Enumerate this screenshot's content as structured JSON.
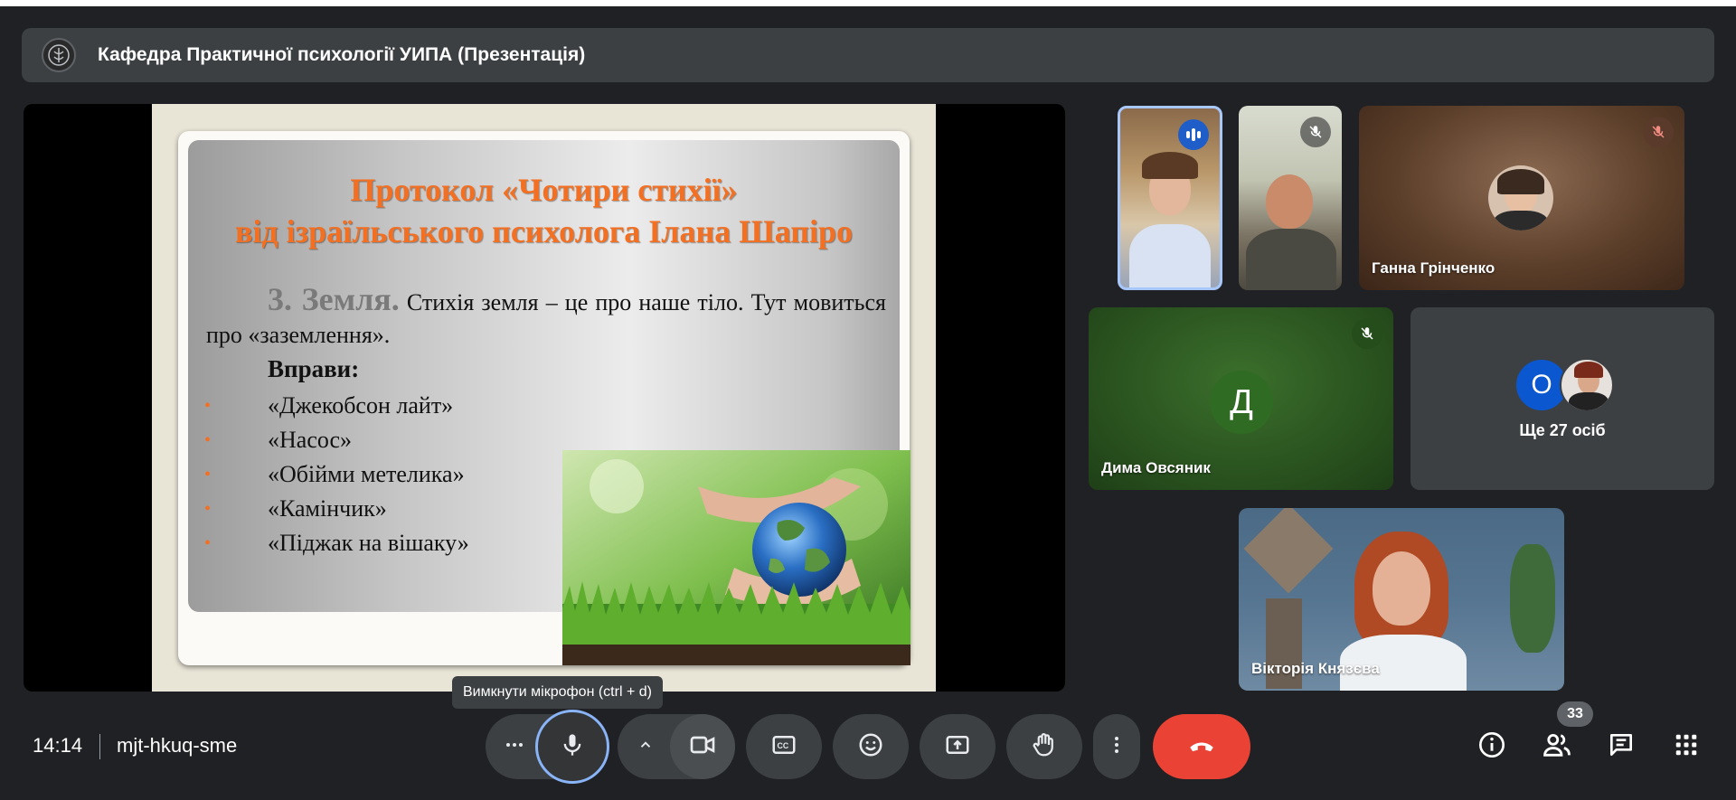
{
  "meeting": {
    "title": "Кафедра Практичної психології УИПА (Презентація)",
    "time": "14:14",
    "code": "mjt-hkuq-sme"
  },
  "slide": {
    "title_line1": "Протокол «Чотири стихії»",
    "title_line2": "від ізраїльського психолога Ілана Шапіро",
    "section": "3. Земля.",
    "body": "Стихія земля – це про наше тіло. Тут мовиться про «заземлення».",
    "exercises_heading": "Вправи:",
    "bullet_char": "•",
    "exercises": [
      "«Джекобсон лайт»",
      "«Насос»",
      "«Обійми метелика»",
      "«Камінчик»",
      "«Піджак на вішаку»"
    ]
  },
  "participants": {
    "tile3_name": "Ганна Грінченко",
    "tile4_name": "Дима Овсяник",
    "tile4_initial": "Д",
    "tile5_initial": "О",
    "tile5_more": "Ще 27 осіб",
    "tile6_name": "Вікторія Князєва"
  },
  "tooltip": "Вимкнути мікрофон (ctrl + d)",
  "controls": {
    "people_count": "33",
    "more_icon": "more-horiz-icon",
    "mic_icon": "mic-icon",
    "camera_icon": "videocam-icon",
    "captions_icon": "closed-caption-icon",
    "emoji_icon": "emoji-icon",
    "present_icon": "present-screen-icon",
    "hand_icon": "raise-hand-icon",
    "leave_icon": "call-end-icon"
  },
  "colors": {
    "accent": "#8ab4f8",
    "leave": "#ea4335",
    "slide_title": "#f36f21",
    "speaking": "#1f5ec9"
  }
}
